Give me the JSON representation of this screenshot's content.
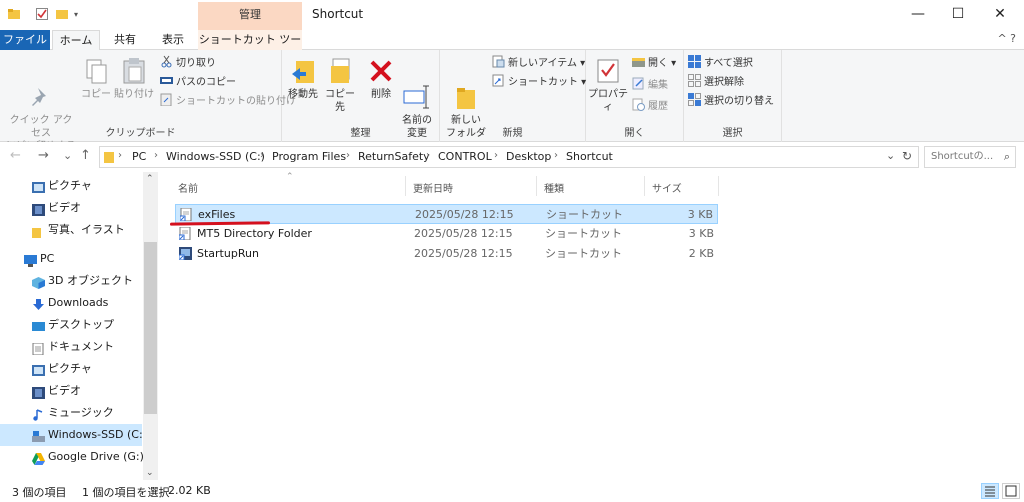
{
  "titlebar": {
    "context_tab": "管理",
    "title": "Shortcut",
    "minimize": "—",
    "maximize": "☐",
    "close": "✕"
  },
  "tabs": {
    "file": "ファイル",
    "home": "ホーム",
    "share": "共有",
    "view": "表示",
    "shortcut_tools": "ショートカット ツール",
    "help": "^ ?"
  },
  "ribbon": {
    "clipboard": {
      "label": "クリップボード",
      "pin": "クイック アクセス\nにピン留めする",
      "copy": "コピー",
      "paste": "貼り付け",
      "cut": "切り取り",
      "copy_path": "パスのコピー",
      "paste_shortcut": "ショートカットの貼り付け"
    },
    "organize": {
      "label": "整理",
      "move_to": "移動先",
      "copy_to": "コピー先",
      "delete": "削除",
      "rename": "名前の\n変更"
    },
    "new": {
      "label": "新規",
      "new_folder": "新しい\nフォルダー",
      "new_item": "新しいアイテム ▾",
      "shortcut": "ショートカット ▾"
    },
    "open": {
      "label": "開く",
      "properties": "プロパティ",
      "open": "開く ▾",
      "edit": "編集",
      "history": "履歴"
    },
    "select": {
      "label": "選択",
      "select_all": "すべて選択",
      "select_none": "選択解除",
      "invert": "選択の切り替え"
    }
  },
  "address": {
    "back": "←",
    "forward": "→",
    "recent": "⌄",
    "up": "↑",
    "crumbs": [
      "PC",
      "Windows-SSD (C:)",
      "Program Files",
      "ReturnSafety",
      "CONTROL",
      "Desktop",
      "Shortcut"
    ],
    "search_placeholder": "Shortcutの..."
  },
  "navpane": {
    "items": [
      {
        "label": "ピクチャ",
        "icon": "pictures-icon"
      },
      {
        "label": "ビデオ",
        "icon": "videos-icon"
      },
      {
        "label": "写真、イラスト",
        "icon": "folder-icon"
      },
      {
        "label": "PC",
        "icon": "pc-icon"
      },
      {
        "label": "3D オブジェクト",
        "icon": "3d-objects-icon"
      },
      {
        "label": "Downloads",
        "icon": "downloads-icon"
      },
      {
        "label": "デスクトップ",
        "icon": "desktop-icon"
      },
      {
        "label": "ドキュメント",
        "icon": "documents-icon"
      },
      {
        "label": "ピクチャ",
        "icon": "pictures-icon"
      },
      {
        "label": "ビデオ",
        "icon": "videos-icon"
      },
      {
        "label": "ミュージック",
        "icon": "music-icon"
      },
      {
        "label": "Windows-SSD (C:)",
        "icon": "drive-icon"
      },
      {
        "label": "Google Drive (G:)",
        "icon": "google-drive-icon"
      }
    ]
  },
  "filelist": {
    "headers": {
      "name": "名前",
      "date": "更新日時",
      "type": "種類",
      "size": "サイズ"
    },
    "files": [
      {
        "name": "exFiles",
        "date": "2025/05/28 12:15",
        "type": "ショートカット",
        "size": "3 KB"
      },
      {
        "name": "MT5 Directory Folder",
        "date": "2025/05/28 12:15",
        "type": "ショートカット",
        "size": "3 KB"
      },
      {
        "name": "StartupRun",
        "date": "2025/05/28 12:15",
        "type": "ショートカット",
        "size": "2 KB"
      }
    ]
  },
  "status": {
    "count": "3 個の項目",
    "selected": "1 個の項目を選択",
    "size": "2.02 KB"
  },
  "colors": {
    "accent": "#1966b5",
    "selection": "#cce8ff",
    "context_tab": "#fbd8c3",
    "annotation": "#d4101e"
  }
}
